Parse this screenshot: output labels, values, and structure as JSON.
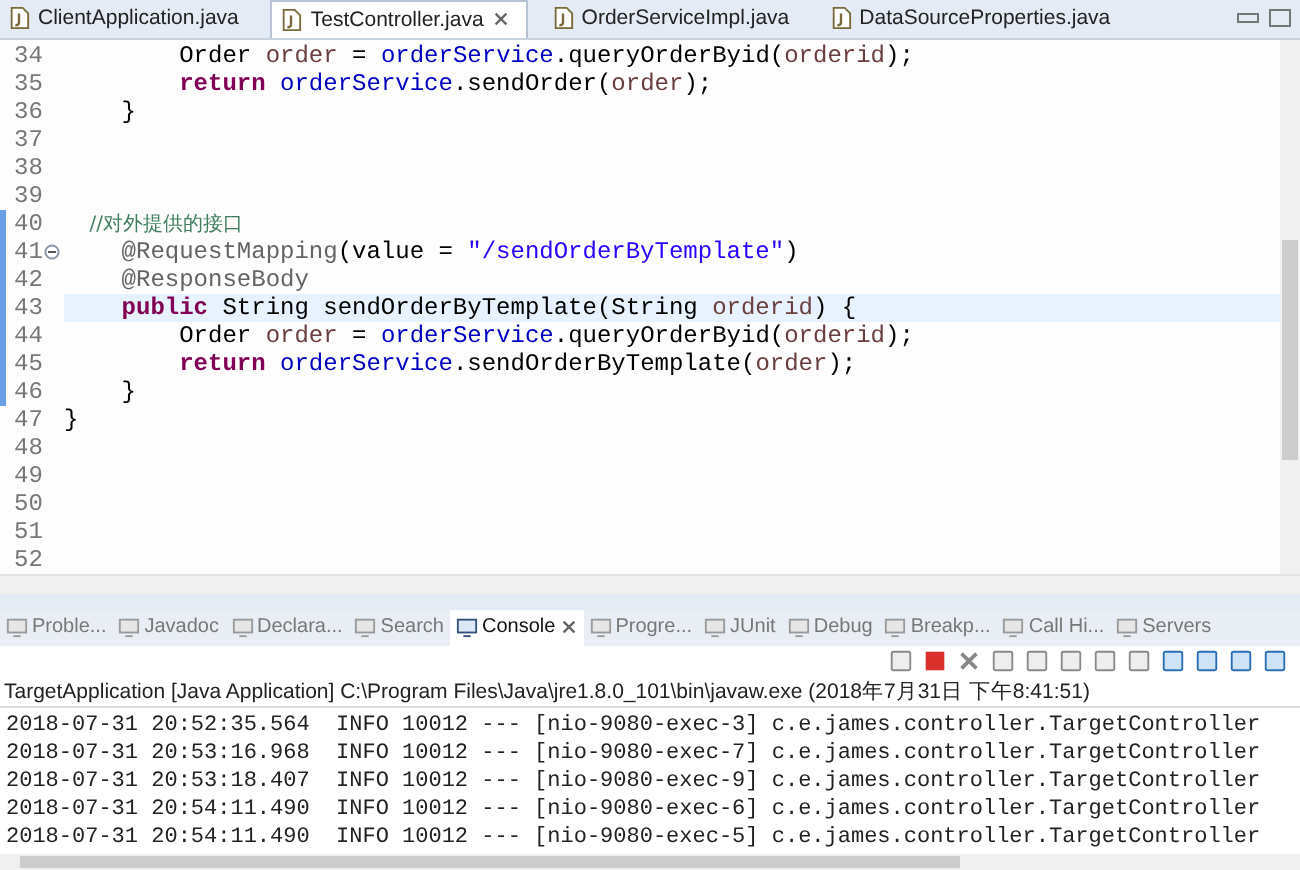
{
  "editor_tabs": [
    {
      "label": "ClientApplication.java",
      "selected": false
    },
    {
      "label": "TestController.java",
      "selected": true
    },
    {
      "label": "OrderServiceImpl.java",
      "selected": false
    },
    {
      "label": "DataSourceProperties.java",
      "selected": false
    }
  ],
  "code_lines": [
    {
      "number": "34",
      "current": false,
      "changed": false,
      "foldable": false,
      "segments": [
        {
          "kind": "plain",
          "text": "        Order "
        },
        {
          "kind": "var",
          "text": "order"
        },
        {
          "kind": "plain",
          "text": " = "
        },
        {
          "kind": "field",
          "text": "orderService"
        },
        {
          "kind": "plain",
          "text": ".queryOrderByid("
        },
        {
          "kind": "var",
          "text": "orderid"
        },
        {
          "kind": "plain",
          "text": ");"
        }
      ]
    },
    {
      "number": "35",
      "current": false,
      "changed": false,
      "foldable": false,
      "segments": [
        {
          "kind": "keyword",
          "text": "        return"
        },
        {
          "kind": "field",
          "text": " orderService"
        },
        {
          "kind": "plain",
          "text": ".sendOrder("
        },
        {
          "kind": "var",
          "text": "order"
        },
        {
          "kind": "plain",
          "text": ");"
        }
      ]
    },
    {
      "number": "36",
      "current": false,
      "changed": false,
      "foldable": false,
      "segments": [
        {
          "kind": "plain",
          "text": "    }"
        }
      ]
    },
    {
      "number": "37",
      "current": false,
      "changed": false,
      "foldable": false
    },
    {
      "number": "38",
      "current": false,
      "changed": false,
      "foldable": false
    },
    {
      "number": "39",
      "current": false,
      "changed": false,
      "foldable": false
    },
    {
      "number": "40",
      "current": false,
      "changed": true,
      "foldable": false,
      "segments": [
        {
          "kind": "comment",
          "text": "    //对外提供的接口"
        }
      ]
    },
    {
      "number": "41",
      "current": false,
      "changed": true,
      "foldable": true,
      "segments": [
        {
          "kind": "annotation",
          "text": "    @RequestMapping"
        },
        {
          "kind": "plain",
          "text": "(value = "
        },
        {
          "kind": "string",
          "text": "\"/sendOrderByTemplate\""
        },
        {
          "kind": "plain",
          "text": ")"
        }
      ]
    },
    {
      "number": "42",
      "current": false,
      "changed": true,
      "foldable": false,
      "segments": [
        {
          "kind": "annotation",
          "text": "    @ResponseBody"
        }
      ]
    },
    {
      "number": "43",
      "current": true,
      "changed": true,
      "foldable": false,
      "segments": [
        {
          "kind": "keyword",
          "text": "    public"
        },
        {
          "kind": "plain",
          "text": " String sendOrderByTemplate(String "
        },
        {
          "kind": "var",
          "text": "orderid"
        },
        {
          "kind": "plain",
          "text": ") {"
        }
      ]
    },
    {
      "number": "44",
      "current": false,
      "changed": true,
      "foldable": false,
      "segments": [
        {
          "kind": "plain",
          "text": "        Order "
        },
        {
          "kind": "var",
          "text": "order"
        },
        {
          "kind": "plain",
          "text": " = "
        },
        {
          "kind": "field",
          "text": "orderService"
        },
        {
          "kind": "plain",
          "text": ".queryOrderByid("
        },
        {
          "kind": "var",
          "text": "orderid"
        },
        {
          "kind": "plain",
          "text": ");"
        }
      ]
    },
    {
      "number": "45",
      "current": false,
      "changed": true,
      "foldable": false,
      "segments": [
        {
          "kind": "keyword",
          "text": "        return"
        },
        {
          "kind": "field",
          "text": " orderService"
        },
        {
          "kind": "plain",
          "text": ".sendOrderByTemplate("
        },
        {
          "kind": "var",
          "text": "order"
        },
        {
          "kind": "plain",
          "text": ");"
        }
      ]
    },
    {
      "number": "46",
      "current": false,
      "changed": true,
      "foldable": false,
      "segments": [
        {
          "kind": "plain",
          "text": "    }"
        }
      ]
    },
    {
      "number": "47",
      "current": false,
      "changed": false,
      "foldable": false,
      "segments": [
        {
          "kind": "plain",
          "text": "}"
        }
      ]
    },
    {
      "number": "48",
      "current": false,
      "changed": false,
      "foldable": false
    },
    {
      "number": "49",
      "current": false,
      "changed": false,
      "foldable": false
    },
    {
      "number": "50",
      "current": false,
      "changed": false,
      "foldable": false
    },
    {
      "number": "51",
      "current": false,
      "changed": false,
      "foldable": false
    },
    {
      "number": "52",
      "current": false,
      "changed": false,
      "foldable": false
    }
  ],
  "view_tabs": [
    {
      "label": "Proble...",
      "selected": false
    },
    {
      "label": "Javadoc",
      "selected": false
    },
    {
      "label": "Declara...",
      "selected": false
    },
    {
      "label": "Search",
      "selected": false
    },
    {
      "label": "Console",
      "selected": true
    },
    {
      "label": "Progre...",
      "selected": false
    },
    {
      "label": "JUnit",
      "selected": false
    },
    {
      "label": "Debug",
      "selected": false
    },
    {
      "label": "Breakp...",
      "selected": false
    },
    {
      "label": "Call Hi...",
      "selected": false
    },
    {
      "label": "Servers",
      "selected": false
    }
  ],
  "console": {
    "header": "TargetApplication [Java Application] C:\\Program Files\\Java\\jre1.8.0_101\\bin\\javaw.exe (2018年7月31日 下午8:41:51)",
    "lines": [
      "2018-07-31 20:52:35.564  INFO 10012 --- [nio-9080-exec-3] c.e.james.controller.TargetController",
      "2018-07-31 20:53:16.968  INFO 10012 --- [nio-9080-exec-7] c.e.james.controller.TargetController",
      "2018-07-31 20:53:18.407  INFO 10012 --- [nio-9080-exec-9] c.e.james.controller.TargetController",
      "2018-07-31 20:54:11.490  INFO 10012 --- [nio-9080-exec-6] c.e.james.controller.TargetController",
      "2018-07-31 20:54:11.490  INFO 10012 --- [nio-9080-exec-5] c.e.james.controller.TargetController"
    ]
  }
}
